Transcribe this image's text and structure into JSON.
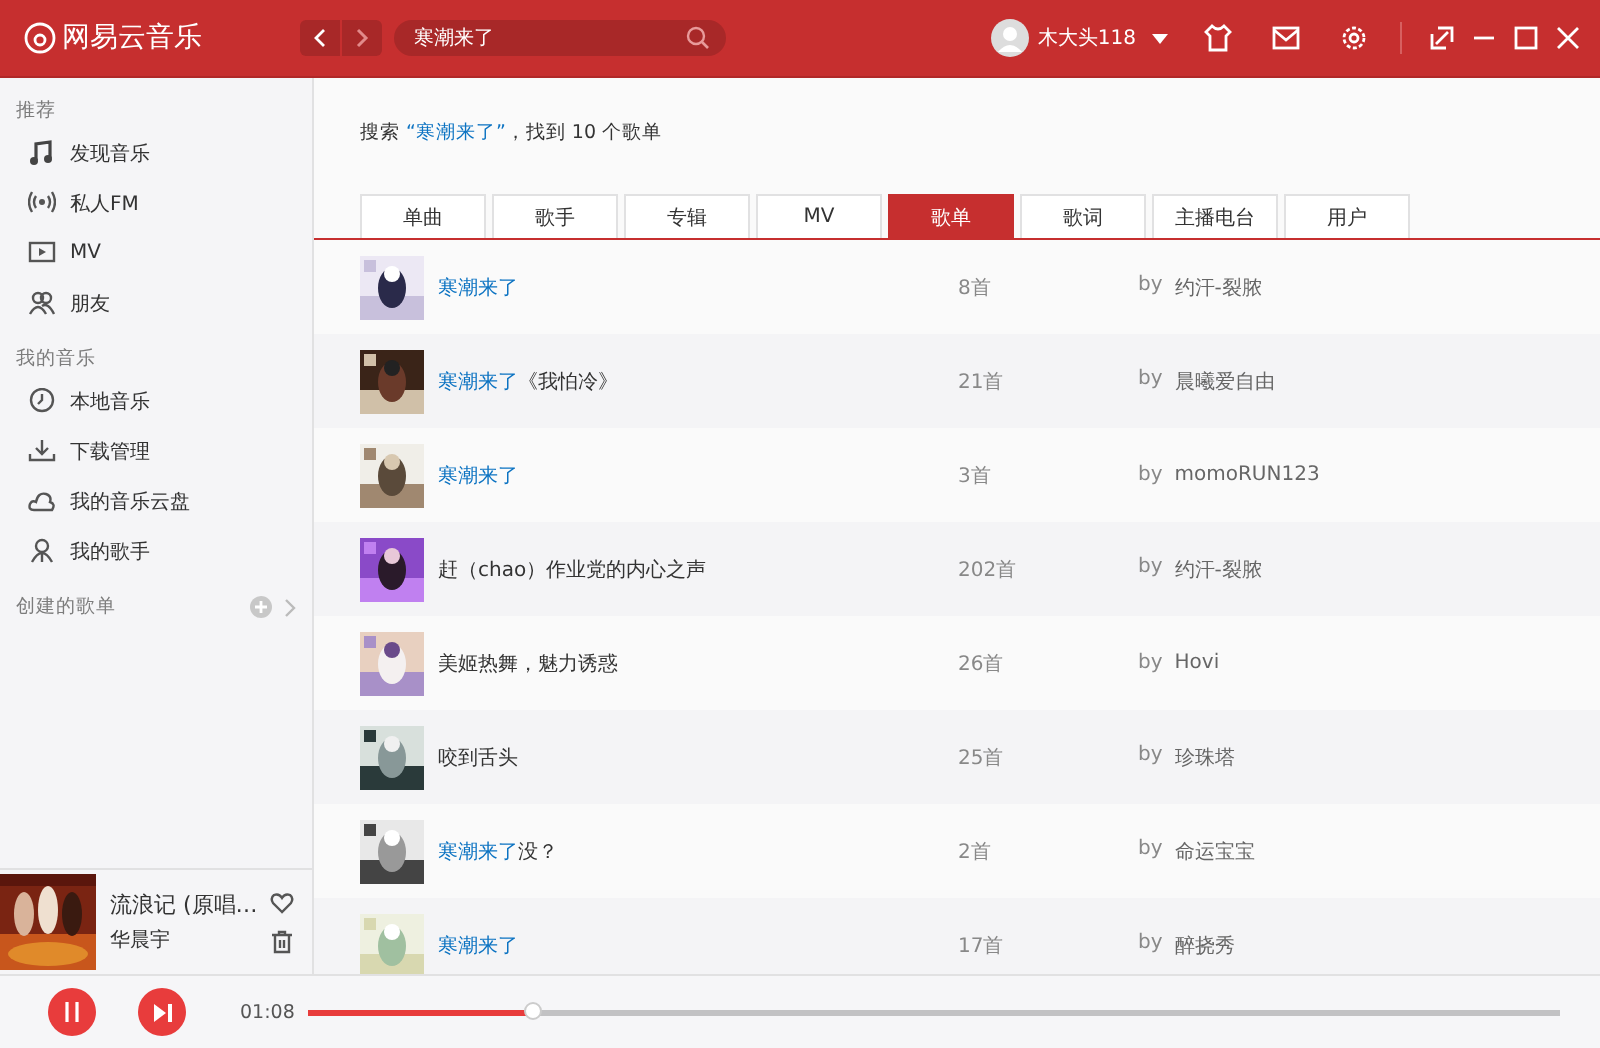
{
  "top_bar": {
    "logo": "网易云音乐",
    "search": {
      "value": "寒潮来了"
    },
    "user": "木大头118"
  },
  "sidebar": {
    "sections": [
      {
        "title": "推荐",
        "items": [
          {
            "label": "发现音乐",
            "selected": false
          },
          {
            "label": "私人FM",
            "selected": false
          },
          {
            "label": "MV",
            "selected": false
          },
          {
            "label": "朋友",
            "selected": false
          }
        ]
      },
      {
        "title": "我的音乐",
        "items": [
          {
            "label": "本地音乐",
            "selected": false
          },
          {
            "label": "下载管理",
            "selected": false
          },
          {
            "label": "我的音乐云盘",
            "selected": false
          },
          {
            "label": "我的歌手",
            "selected": false
          }
        ]
      },
      {
        "title": "创建的歌单",
        "add": true
      }
    ],
    "now_playing": {
      "title": "流浪记 (原唱…",
      "artist": "华晨宇"
    }
  },
  "summary": [
    {
      "text": "搜索 ",
      "match": false
    },
    {
      "text": "“寒潮来了”",
      "match": true
    },
    {
      "text": "，找到 10 个歌单",
      "match": false
    }
  ],
  "tabs": [
    {
      "label": "单曲",
      "selected": false
    },
    {
      "label": "歌手",
      "selected": false
    },
    {
      "label": "专辑",
      "selected": false
    },
    {
      "label": "MV",
      "selected": false
    },
    {
      "label": "歌单",
      "selected": true
    },
    {
      "label": "歌词",
      "selected": false
    },
    {
      "label": "主播电台",
      "selected": false
    },
    {
      "label": "用户",
      "selected": false
    }
  ],
  "playlists": [
    {
      "title": [
        {
          "text": "寒潮来了",
          "match": true
        }
      ],
      "count": "8首",
      "by": "by",
      "author": "约汗-裂脓"
    },
    {
      "title": [
        {
          "text": "寒潮来了",
          "match": true
        },
        {
          "text": "《我怕冷》",
          "match": false
        }
      ],
      "count": "21首",
      "by": "by",
      "author": "晨曦爱自由"
    },
    {
      "title": [
        {
          "text": "寒潮来了",
          "match": true
        }
      ],
      "count": "3首",
      "by": "by",
      "author": "momoRUN123"
    },
    {
      "title": [
        {
          "text": "赶（chao）作业党的内心之声",
          "match": false
        }
      ],
      "count": "202首",
      "by": "by",
      "author": "约汗-裂脓"
    },
    {
      "title": [
        {
          "text": "美姬热舞，魅力诱惑",
          "match": false
        }
      ],
      "count": "26首",
      "by": "by",
      "author": "Hovi"
    },
    {
      "title": [
        {
          "text": "咬到舌头",
          "match": false
        }
      ],
      "count": "25首",
      "by": "by",
      "author": "珍珠塔"
    },
    {
      "title": [
        {
          "text": "寒潮来了",
          "match": true
        },
        {
          "text": "没？",
          "match": false
        }
      ],
      "count": "2首",
      "by": "by",
      "author": "命运宝宝"
    },
    {
      "title": [
        {
          "text": "寒潮来了",
          "match": true
        }
      ],
      "count": "17首",
      "by": "by",
      "author": "醉挠秀"
    }
  ],
  "player": {
    "playing": true,
    "elapsed": "01:08",
    "level": 0.18
  }
}
